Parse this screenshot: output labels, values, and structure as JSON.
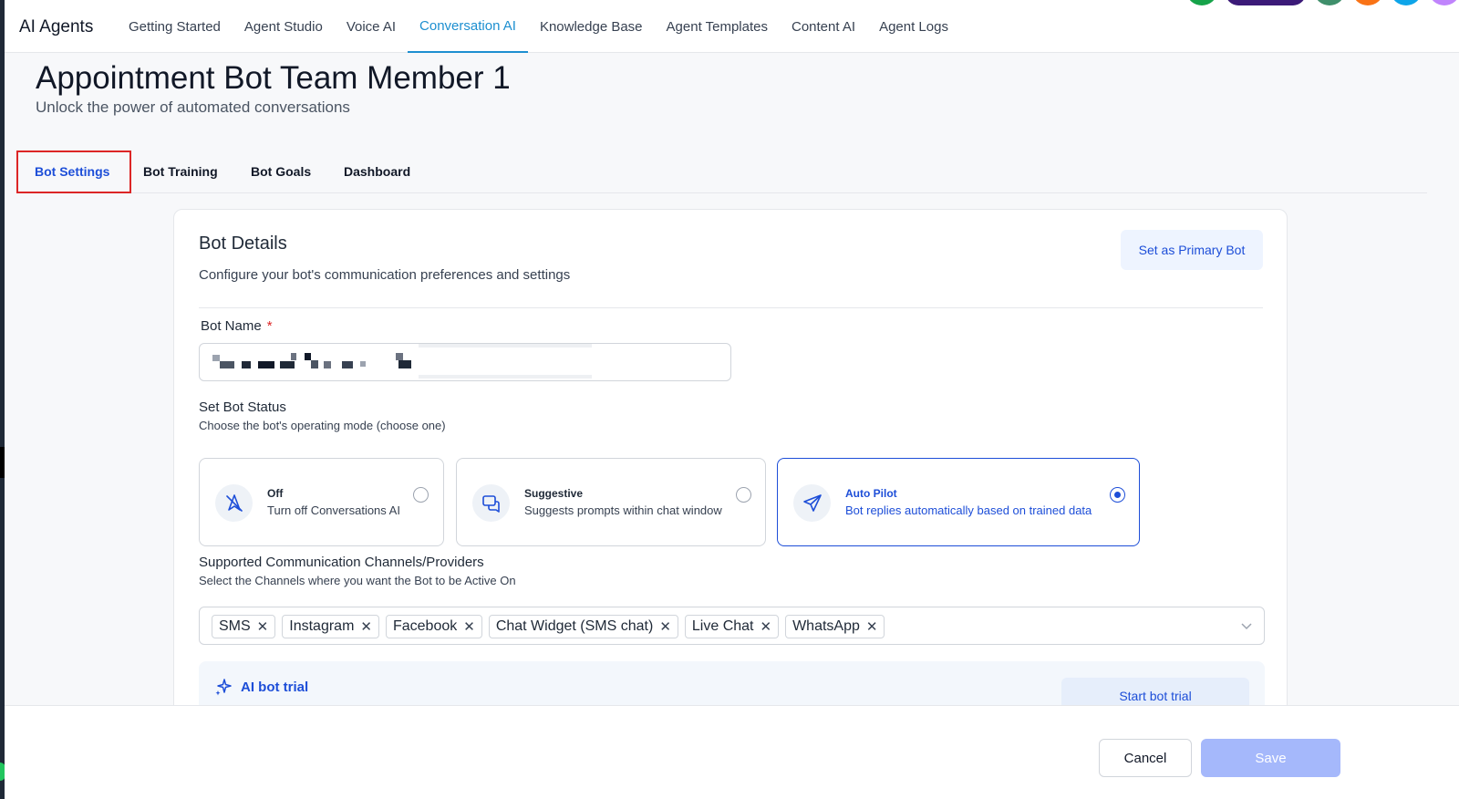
{
  "app": {
    "title": "AI Agents"
  },
  "topnav": {
    "tabs": [
      {
        "label": "Getting Started"
      },
      {
        "label": "Agent Studio"
      },
      {
        "label": "Voice AI"
      },
      {
        "label": "Conversation AI"
      },
      {
        "label": "Knowledge Base"
      },
      {
        "label": "Agent Templates"
      },
      {
        "label": "Content AI"
      },
      {
        "label": "Agent Logs"
      }
    ],
    "active_tab": "Conversation AI"
  },
  "page": {
    "title": "Appointment Bot Team Member 1",
    "subtitle": "Unlock the power of automated conversations"
  },
  "subtabs": [
    {
      "label": "Bot Settings"
    },
    {
      "label": "Bot Training"
    },
    {
      "label": "Bot Goals"
    },
    {
      "label": "Dashboard"
    }
  ],
  "bot_details": {
    "title": "Bot Details",
    "description": "Configure your bot's communication preferences and settings",
    "primary_button": "Set as Primary Bot",
    "bot_name_label": "Bot Name",
    "required_marker": "*",
    "bot_name_value": "",
    "status_label": "Set Bot Status",
    "status_sublabel": "Choose the bot's operating mode (choose one)",
    "status_options": [
      {
        "title": "Off",
        "description": "Turn off Conversations AI",
        "icon": "bell-off-icon",
        "selected": false
      },
      {
        "title": "Suggestive",
        "description": "Suggests prompts within chat window",
        "icon": "chat-bubbles-icon",
        "selected": false
      },
      {
        "title": "Auto Pilot",
        "description": "Bot replies automatically based on trained data",
        "icon": "send-plane-icon",
        "selected": true
      }
    ],
    "channels_label": "Supported Communication Channels/Providers",
    "channels_sublabel": "Select the Channels where you want the Bot to be Active On",
    "channels": [
      "SMS",
      "Instagram",
      "Facebook",
      "Chat Widget (SMS chat)",
      "Live Chat",
      "WhatsApp"
    ],
    "trial_label": "AI bot trial",
    "trial_button": "Start bot trial"
  },
  "footer": {
    "cancel": "Cancel",
    "save": "Save"
  },
  "colors": {
    "accent": "#1d4ed8",
    "nav_active": "#1d8fd0",
    "highlight_box": "#dc2626",
    "save_disabled": "#a5b8fb"
  }
}
